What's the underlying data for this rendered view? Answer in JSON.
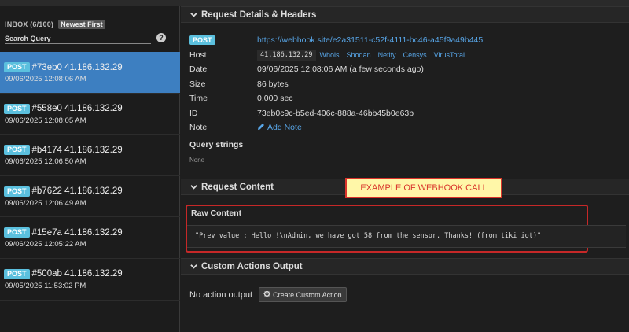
{
  "sidebar": {
    "inbox_label": "INBOX (6/100)",
    "sort_label": "Newest First",
    "search_placeholder": "Search Query",
    "help_glyph": "?",
    "requests": [
      {
        "method": "POST",
        "title": "#73eb0 41.186.132.29",
        "date": "09/06/2025 12:08:06 AM",
        "selected": true
      },
      {
        "method": "POST",
        "title": "#558e0 41.186.132.29",
        "date": "09/06/2025 12:08:05 AM",
        "selected": false
      },
      {
        "method": "POST",
        "title": "#b4174 41.186.132.29",
        "date": "09/06/2025 12:06:50 AM",
        "selected": false
      },
      {
        "method": "POST",
        "title": "#b7622 41.186.132.29",
        "date": "09/06/2025 12:06:49 AM",
        "selected": false
      },
      {
        "method": "POST",
        "title": "#15e7a 41.186.132.29",
        "date": "09/06/2025 12:05:22 AM",
        "selected": false
      },
      {
        "method": "POST",
        "title": "#500ab 41.186.132.29",
        "date": "09/05/2025 11:53:02 PM",
        "selected": false
      }
    ]
  },
  "details": {
    "header": "Request Details & Headers",
    "method": "POST",
    "url": "https://webhook.site/e2a31511-c52f-4111-bc46-a45f9a49b445",
    "host_label": "Host",
    "host_value": "41.186.132.29",
    "host_links": [
      "Whois",
      "Shodan",
      "Netify",
      "Censys",
      "VirusTotal"
    ],
    "date_label": "Date",
    "date_value": "09/06/2025 12:08:06 AM (a few seconds ago)",
    "size_label": "Size",
    "size_value": "86 bytes",
    "time_label": "Time",
    "time_value": "0.000 sec",
    "id_label": "ID",
    "id_value": "73eb0c9c-b5ed-406c-888a-46bb45b0e63b",
    "note_label": "Note",
    "add_note": "Add Note",
    "query_title": "Query strings",
    "query_none": "None"
  },
  "content": {
    "header": "Request Content",
    "callout": "EXAMPLE OF WEBHOOK CALL",
    "raw_title": "Raw Content",
    "raw_body": "\"Prev value : Hello !\\nAdmin, we have got 58 from the sensor. Thanks! (from tiki iot)\""
  },
  "custom_actions": {
    "header": "Custom Actions Output",
    "empty_text": "No action output",
    "create_button": "Create Custom Action"
  },
  "colors": {
    "selected_bg": "#3d7fc1",
    "method_badge": "#5bc0de",
    "link": "#58a6e8",
    "highlight_border": "#c62828",
    "callout_bg": "#fff7a8"
  }
}
